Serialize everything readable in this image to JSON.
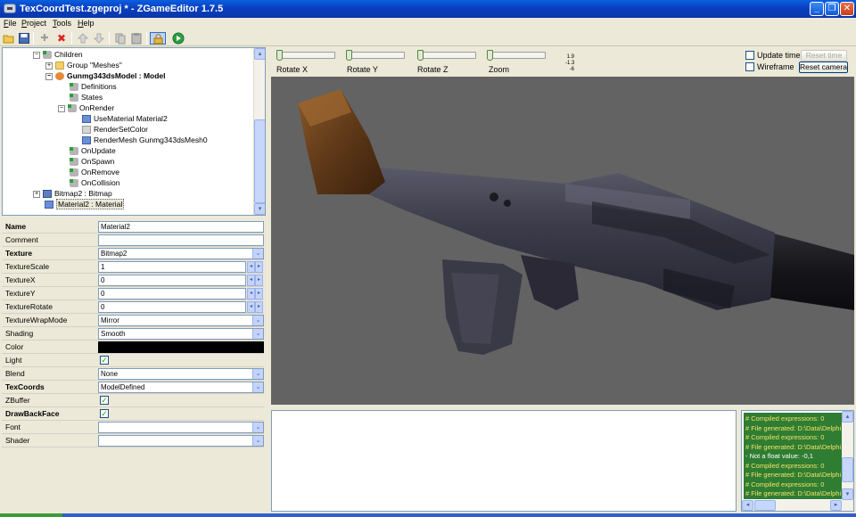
{
  "window": {
    "title": "TexCoordTest.zgeproj * - ZGameEditor 1.7.5",
    "min_glyph": "_",
    "max_glyph": "❐",
    "close_glyph": "✕"
  },
  "menu": [
    {
      "label": "File",
      "accel": "F",
      "rest": "ile"
    },
    {
      "label": "Project",
      "accel": "P",
      "rest": "roject"
    },
    {
      "label": "Tools",
      "accel": "T",
      "rest": "ools"
    },
    {
      "label": "Help",
      "accel": "H",
      "rest": "elp"
    }
  ],
  "toolbar": {
    "icons": [
      "open-folder-icon",
      "save-icon",
      "add-icon",
      "delete-icon",
      "move-up-icon",
      "move-down-icon",
      "copy-icon",
      "paste-icon",
      "lock-icon",
      "run-icon"
    ],
    "delete_glyph": "✖",
    "add_glyph": "✚",
    "run_glyph": "▶"
  },
  "tree": [
    {
      "label": "Children",
      "indent": 0,
      "icon": "gear",
      "expander": "-"
    },
    {
      "label": "Group \"Meshes\"",
      "indent": 1,
      "icon": "folder",
      "expander": "+"
    },
    {
      "label": "Gunmg343dsModel : Model",
      "indent": 1,
      "icon": "model",
      "expander": "-",
      "bold": true
    },
    {
      "label": "Definitions",
      "indent": 2,
      "icon": "gear"
    },
    {
      "label": "States",
      "indent": 2,
      "icon": "gear"
    },
    {
      "label": "OnRender",
      "indent": 2,
      "icon": "gear",
      "expander": "-"
    },
    {
      "label": "UseMaterial  Material2",
      "indent": 3,
      "icon": "material"
    },
    {
      "label": "RenderSetColor",
      "indent": 3,
      "icon": "cmd"
    },
    {
      "label": "RenderMesh  Gunmg343dsMesh0",
      "indent": 3,
      "icon": "material"
    },
    {
      "label": "OnUpdate",
      "indent": 2,
      "icon": "gear"
    },
    {
      "label": "OnSpawn",
      "indent": 2,
      "icon": "gear"
    },
    {
      "label": "OnRemove",
      "indent": 2,
      "icon": "gear"
    },
    {
      "label": "OnCollision",
      "indent": 2,
      "icon": "gear"
    },
    {
      "label": "Bitmap2 : Bitmap",
      "indent": 0,
      "icon": "bitmap",
      "expander": "+"
    },
    {
      "label": "Material2 : Material",
      "indent": 0,
      "icon": "material",
      "selected": true
    }
  ],
  "properties": [
    {
      "name": "Name",
      "value": "Material2",
      "kind": "text",
      "bold": true
    },
    {
      "name": "Comment",
      "value": "",
      "kind": "text"
    },
    {
      "name": "Texture",
      "value": "Bitmap2",
      "kind": "dropdown",
      "bold": true
    },
    {
      "name": "TextureScale",
      "value": "1",
      "kind": "spin"
    },
    {
      "name": "TextureX",
      "value": "0",
      "kind": "spin"
    },
    {
      "name": "TextureY",
      "value": "0",
      "kind": "spin"
    },
    {
      "name": "TextureRotate",
      "value": "0",
      "kind": "spin"
    },
    {
      "name": "TextureWrapMode",
      "value": "Mirror",
      "kind": "dropdown"
    },
    {
      "name": "Shading",
      "value": "Smooth",
      "kind": "dropdown"
    },
    {
      "name": "Color",
      "value": "",
      "kind": "color"
    },
    {
      "name": "Light",
      "value": "",
      "kind": "check",
      "checked": true
    },
    {
      "name": "Blend",
      "value": "None",
      "kind": "dropdown"
    },
    {
      "name": "TexCoords",
      "value": "ModelDefined",
      "kind": "dropdown",
      "bold": true
    },
    {
      "name": "ZBuffer",
      "value": "",
      "kind": "check",
      "checked": true
    },
    {
      "name": "DrawBackFace",
      "value": "",
      "kind": "check",
      "checked": true,
      "bold": true
    },
    {
      "name": "Font",
      "value": "",
      "kind": "dropdown"
    },
    {
      "name": "Shader",
      "value": "",
      "kind": "dropdown"
    }
  ],
  "sliders": [
    {
      "label": "Rotate X",
      "level": 0
    },
    {
      "label": "Rotate Y",
      "level": 0
    },
    {
      "label": "Rotate Z",
      "level": 0
    },
    {
      "label": "Zoom",
      "level": 0
    }
  ],
  "zoom_readout": [
    "1.9",
    "-1.3",
    "-6"
  ],
  "preview": {
    "update_time_label": "Update time",
    "reset_time_label": "Reset time",
    "wireframe_label": "Wireframe",
    "reset_camera_label": "Reset camera",
    "update_time_checked": false,
    "wireframe_checked": false
  },
  "log": [
    {
      "text": "# Compiled expressions: 0",
      "style": "yellow"
    },
    {
      "text": "# File generated: D:\\Data\\Delphi",
      "style": "yellow"
    },
    {
      "text": "# Compiled expressions: 0",
      "style": "yellow"
    },
    {
      "text": "# File generated: D:\\Data\\Delphi",
      "style": "yellow"
    },
    {
      "text": "- Not a float value: -0,1",
      "style": "white"
    },
    {
      "text": "# Compiled expressions: 0",
      "style": "yellow"
    },
    {
      "text": "# File generated: D:\\Data\\Delphi",
      "style": "yellow"
    },
    {
      "text": "# Compiled expressions: 0",
      "style": "yellow"
    },
    {
      "text": "# File generated: D:\\Data\\Delphi",
      "style": "yellow"
    }
  ],
  "colors": {
    "viewport_bg": "#636363",
    "log_bg": "#2e7d32",
    "log_text": "#f5e26b",
    "titlebar": "#0a46d0"
  },
  "glyphs": {
    "check": "✓",
    "dd": "⌄",
    "spin_left": "◂",
    "spin_right": "▸",
    "up": "▴",
    "down": "▾",
    "left": "◂",
    "right": "▸",
    "plus": "+",
    "minus": "−"
  }
}
